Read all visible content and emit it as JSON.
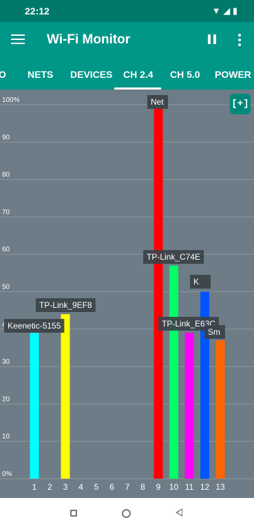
{
  "status": {
    "time": "22:12"
  },
  "app": {
    "title": "Wi-Fi Monitor"
  },
  "tabs": [
    {
      "label": "O"
    },
    {
      "label": "NETS"
    },
    {
      "label": "DEVICES"
    },
    {
      "label": "CH 2.4",
      "active": true
    },
    {
      "label": "CH 5.0"
    },
    {
      "label": "POWER"
    }
  ],
  "fab": {
    "label": "[+]"
  },
  "chart_data": {
    "type": "bar",
    "ytick_labels": [
      "0%",
      "10",
      "20",
      "30",
      "40",
      "50",
      "60",
      "70",
      "80",
      "90",
      "100%"
    ],
    "ylim": [
      0,
      100
    ],
    "x_channels": [
      "1",
      "2",
      "3",
      "4",
      "5",
      "6",
      "7",
      "8",
      "9",
      "10",
      "11",
      "12",
      "13"
    ],
    "bars": [
      {
        "channel": 1,
        "value": 39,
        "color": "#00ffff",
        "label": "Keenetic-5155"
      },
      {
        "channel": 3,
        "value": 44,
        "color": "#ffff00",
        "label": "TP-Link_9EF8"
      },
      {
        "channel": 9,
        "value": 99,
        "color": "#ff0000",
        "label": "Net"
      },
      {
        "channel": 10,
        "value": 57,
        "color": "#00ff66",
        "label": "TP-Link_C74E"
      },
      {
        "channel": 11,
        "value": 39,
        "color": "#ff00ff",
        "label": "TP-Link_E63C"
      },
      {
        "channel": 12,
        "value": 50,
        "color": "#0055ff",
        "label": "K"
      },
      {
        "channel": 13,
        "value": 37,
        "color": "#ff6600",
        "label": "Sm"
      }
    ],
    "grid": true
  },
  "icons": [
    "menu-icon",
    "pause-icon",
    "more-icon",
    "wifi-icon",
    "signal-icon",
    "battery-icon"
  ]
}
